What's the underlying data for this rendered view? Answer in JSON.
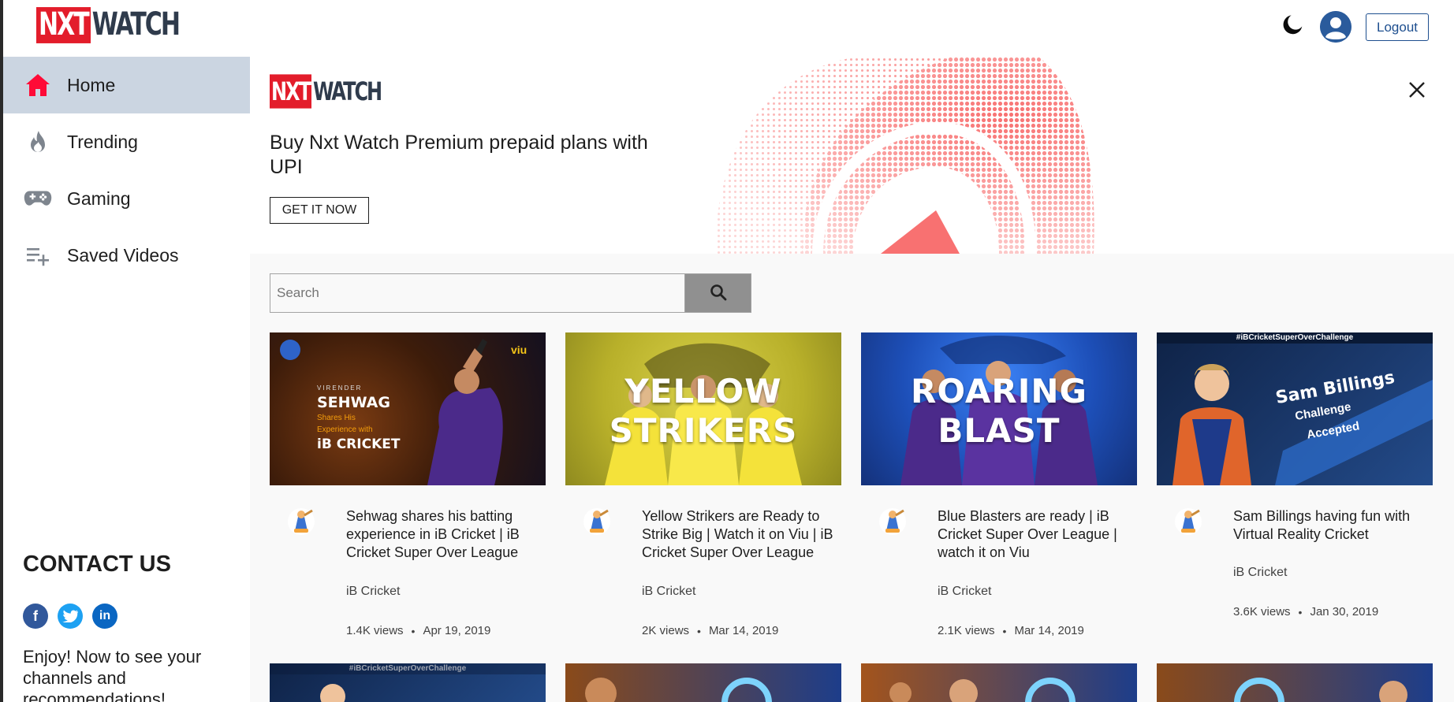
{
  "header": {
    "logo_nxt": "NXT",
    "logo_watch": "WATCH",
    "logout_label": "Logout",
    "theme_icon": "moon-icon",
    "profile_icon": "avatar-icon"
  },
  "sidebar": {
    "items": [
      {
        "label": "Home",
        "icon": "home-icon",
        "active": true
      },
      {
        "label": "Trending",
        "icon": "fire-icon",
        "active": false
      },
      {
        "label": "Gaming",
        "icon": "gamepad-icon",
        "active": false
      },
      {
        "label": "Saved Videos",
        "icon": "playlist-add-icon",
        "active": false
      }
    ],
    "contact_title": "CONTACT US",
    "socials": [
      "facebook-icon",
      "twitter-icon",
      "linkedin-icon"
    ],
    "enjoy_text": "Enjoy! Now to see your channels and recommendations!"
  },
  "banner": {
    "logo_nxt": "NXT",
    "logo_watch": "WATCH",
    "text": "Buy Nxt Watch Premium prepaid plans with UPI",
    "button_label": "GET IT NOW",
    "close_icon": "close-icon"
  },
  "search": {
    "placeholder": "Search",
    "button_icon": "search-icon"
  },
  "videos": [
    {
      "title": "Sehwag shares his batting experience in iB Cricket | iB Cricket Super Over League",
      "channel": "iB Cricket",
      "views": "1.4K views",
      "date": "Apr 19, 2019",
      "thumb_text": [
        "VIRENDER",
        "SEHWAG",
        "Shares His",
        "Experience with",
        "iB CRICKET"
      ],
      "thumb_badge": "viu"
    },
    {
      "title": "Yellow Strikers are Ready to Strike Big | Watch it on Viu | iB Cricket Super Over League",
      "channel": "iB Cricket",
      "views": "2K views",
      "date": "Mar 14, 2019",
      "thumb_text": [
        "YELLOW",
        "STRIKERS"
      ]
    },
    {
      "title": "Blue Blasters are ready | iB Cricket Super Over League | watch it on Viu",
      "channel": "iB Cricket",
      "views": "2.1K views",
      "date": "Mar 14, 2019",
      "thumb_text": [
        "ROARING",
        "BLAST"
      ]
    },
    {
      "title": "Sam Billings having fun with Virtual Reality Cricket",
      "channel": "iB Cricket",
      "views": "3.6K views",
      "date": "Jan 30, 2019",
      "thumb_text": [
        "#iBCricketSuperOverChallenge",
        "Sam Billings",
        "Challenge",
        "Accepted"
      ]
    }
  ],
  "row2_tag": "#iBCricketSuperOverChallenge",
  "colors": {
    "brand_red": "#e31d2b",
    "active_nav": "#cbd5e1",
    "logout_blue": "#1e4f8f",
    "banner_art": "#f87171"
  }
}
